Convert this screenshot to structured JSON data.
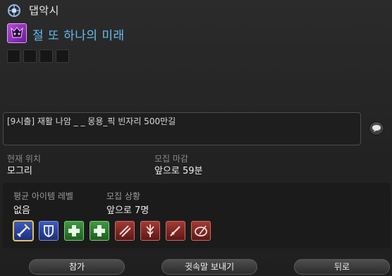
{
  "header": {
    "title": "댑악시",
    "icon": "globe-icon"
  },
  "duty": {
    "name": "절 또 하나의 미래",
    "icon": "ultimate-duty-icon"
  },
  "party_slots": [
    {},
    {},
    {},
    {}
  ],
  "comment": "[9시출] 재활 나암 _ _ 몽용_픽 빈자리 500만길",
  "location": {
    "label": "현재 위치",
    "value": "모그리"
  },
  "deadline": {
    "label": "모집 마감",
    "value": "앞으로 59분"
  },
  "avg_item_level": {
    "label": "평균 아이템 레벨",
    "value": "없음"
  },
  "recruit_status": {
    "label": "모집 상황",
    "value": "앞으로 7명"
  },
  "job_slots": [
    {
      "role": "tank",
      "icon": "paladin-icon",
      "selected": true
    },
    {
      "role": "tank",
      "icon": "shield-icon"
    },
    {
      "role": "healer",
      "icon": "healer-cross-icon"
    },
    {
      "role": "healer",
      "icon": "healer-cross-icon"
    },
    {
      "role": "dps",
      "icon": "slashes-icon"
    },
    {
      "role": "dps",
      "icon": "dragoon-icon"
    },
    {
      "role": "dps",
      "icon": "sword-icon"
    },
    {
      "role": "dps",
      "icon": "palette-icon"
    }
  ],
  "buttons": {
    "join": "참가",
    "whisper": "귓속말 보내기",
    "back": "뒤로"
  },
  "colors": {
    "duty_title": "#64bff0",
    "tank": "#3d5ac4",
    "healer": "#3e9a3e",
    "dps": "#a23a34"
  }
}
